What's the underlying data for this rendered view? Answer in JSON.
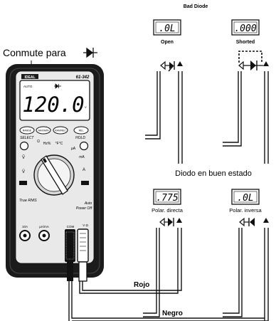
{
  "labels": {
    "bad_diode": "Bad Diode",
    "open": "Open",
    "shorted": "Shorted",
    "switch_to": "Conmute para",
    "good_diode": "Diodo en buen estado",
    "forward_bias": "Polar. directa",
    "reverse_bias": "Polar. inversa",
    "red": "Rojo",
    "black": "Negro"
  },
  "displays": {
    "open": ".0L",
    "shorted": ".000",
    "forward": ".775",
    "reverse": ".0L"
  },
  "meter": {
    "brand": "IDEAL",
    "model": "61-342",
    "reading": "120.0",
    "lcd_auto": "AUTO",
    "lcd_unit": "V",
    "buttons": [
      "RANGE",
      "MAX/MIN",
      "RAN/REC",
      "REL"
    ],
    "select": "SELECT",
    "hold": "HOLD",
    "hz_label": "Hz%",
    "temp_label": "°F°C",
    "ohm_label": "Ω",
    "ua_label": "µA",
    "ma_label": "mA",
    "a_label": "A",
    "v_ac_label": "Ṽ",
    "v_dc_label": "V̄",
    "true_rms": "True RMS",
    "auto": "Auto",
    "power_off": "Power Off",
    "jack_10a": "10A",
    "jack_ua": "µA/mA",
    "jack_com": "COM",
    "jack_v": "V Ω"
  },
  "colors": {
    "case": "#1b1b1b",
    "bezel": "#e9e9e9",
    "lcd": "#ffffff",
    "ink": "#111111"
  },
  "icons": {
    "diode_symbol": "diode-icon",
    "probe_tip": "probe-arrow-icon"
  }
}
